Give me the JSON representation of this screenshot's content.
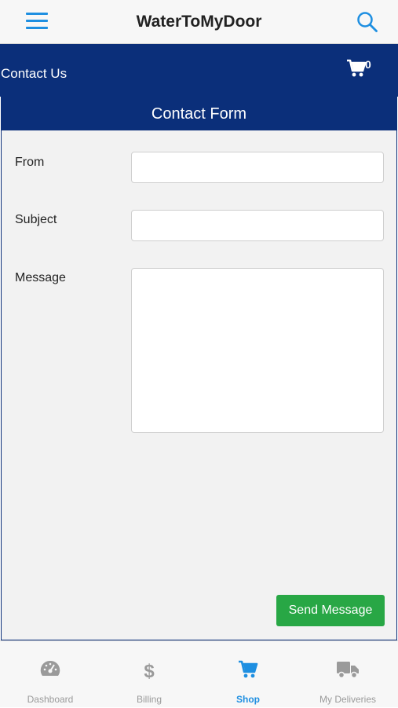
{
  "app": {
    "title": "WaterToMyDoor"
  },
  "subheader": {
    "title": "Contact Us",
    "cart_count": "0"
  },
  "form": {
    "header": "Contact Form",
    "from_label": "From",
    "subject_label": "Subject",
    "message_label": "Message",
    "from_value": "",
    "subject_value": "",
    "message_value": "",
    "send_label": "Send Message"
  },
  "tabs": [
    {
      "label": "Dashboard",
      "icon": "speedometer-icon",
      "active": false
    },
    {
      "label": "Billing",
      "icon": "dollar-icon",
      "active": false
    },
    {
      "label": "Shop",
      "icon": "cart-icon",
      "active": true
    },
    {
      "label": "My Deliveries",
      "icon": "truck-icon",
      "active": false
    }
  ],
  "colors": {
    "accent": "#1e8fe1",
    "navy": "#0b2f7a",
    "send_button": "#28a745",
    "inactive_tab": "#9a9a9a"
  }
}
